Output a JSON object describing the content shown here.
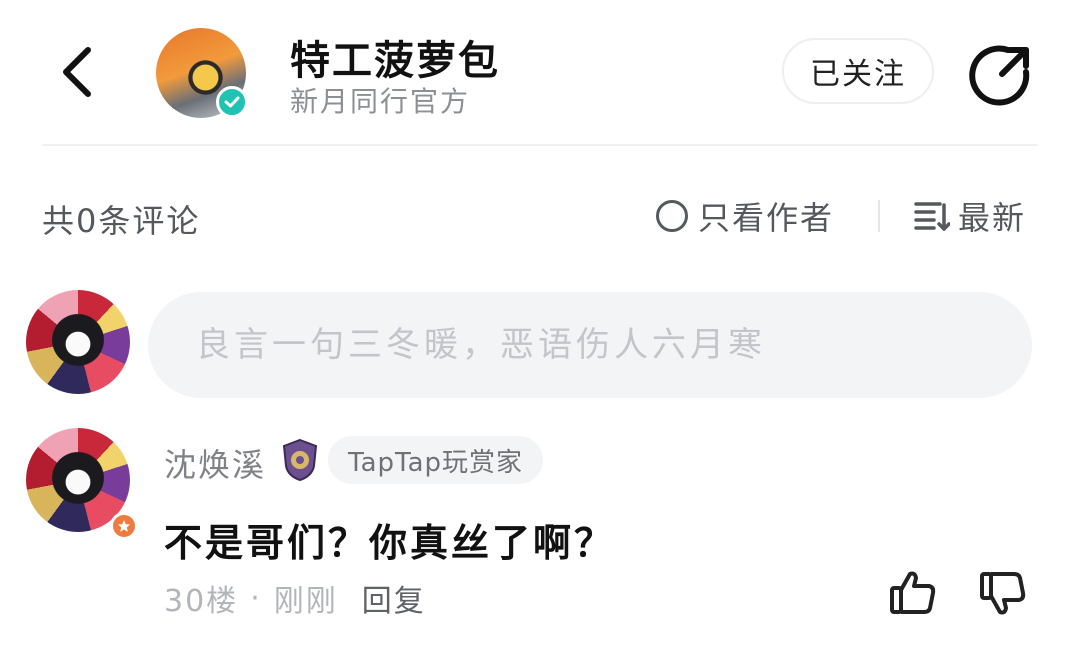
{
  "header": {
    "author_name": "特工菠萝包",
    "author_subtitle": "新月同行官方",
    "follow_label": "已关注"
  },
  "comments_bar": {
    "count_label": "共0条评论",
    "author_only_label": "只看作者",
    "sort_label": "最新"
  },
  "reply_input": {
    "placeholder": "良言一句三冬暖，恶语伤人六月寒"
  },
  "comment": {
    "user_name": "沈焕溪",
    "title_tag": "TapTap玩赏家",
    "text": "不是哥们？你真丝了啊？",
    "floor": "30楼",
    "time": "刚刚",
    "reply_label": "回复"
  },
  "icons": {
    "back": "chevron-left-icon",
    "share": "share-arrow-icon",
    "verified": "check-badge-icon",
    "sort": "sort-lines-icon",
    "like": "thumbs-up-icon",
    "dislike": "thumbs-down-icon"
  },
  "colors": {
    "verified": "#1fc3b3",
    "level_badge": "#f07b3f",
    "muted_text": "#8c8f93",
    "input_bg": "#f3f4f6"
  }
}
